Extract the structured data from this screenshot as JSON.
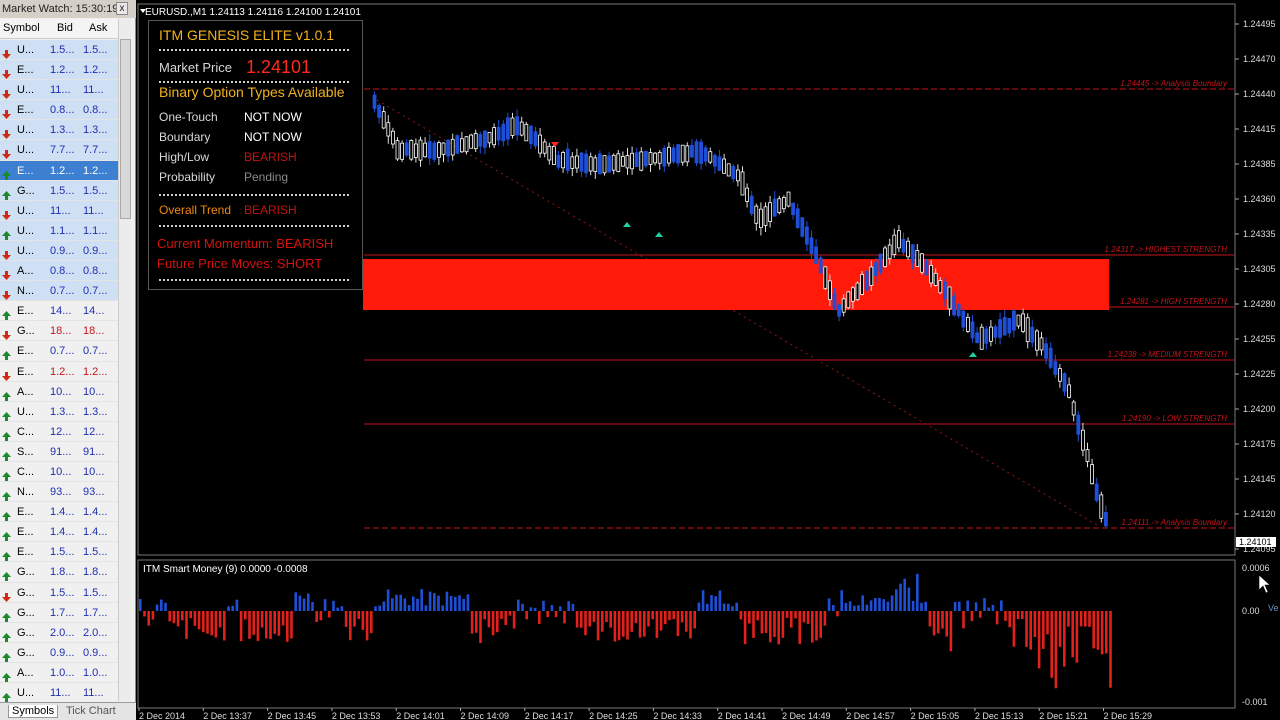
{
  "market_watch": {
    "title": "Market Watch: 15:30:19",
    "close": "x",
    "headers": {
      "symbol": "Symbol",
      "bid": "Bid",
      "ask": "Ask"
    },
    "rows": [
      {
        "symbol": "U...",
        "bid": "1.5...",
        "ask": "1.5...",
        "dir": "down",
        "style": "blue"
      },
      {
        "symbol": "E...",
        "bid": "1.2...",
        "ask": "1.2...",
        "dir": "down",
        "style": "blue"
      },
      {
        "symbol": "U...",
        "bid": "11...",
        "ask": "11...",
        "dir": "down",
        "style": "blue"
      },
      {
        "symbol": "E...",
        "bid": "0.8...",
        "ask": "0.8...",
        "dir": "down",
        "style": "blue"
      },
      {
        "symbol": "U...",
        "bid": "1.3...",
        "ask": "1.3...",
        "dir": "down",
        "style": "blue"
      },
      {
        "symbol": "U...",
        "bid": "7.7...",
        "ask": "7.7...",
        "dir": "down",
        "style": "blue"
      },
      {
        "symbol": "E...",
        "bid": "1.2...",
        "ask": "1.2...",
        "dir": "up",
        "style": "dark"
      },
      {
        "symbol": "G...",
        "bid": "1.5...",
        "ask": "1.5...",
        "dir": "up",
        "style": "blue"
      },
      {
        "symbol": "U...",
        "bid": "11...",
        "ask": "11...",
        "dir": "down",
        "style": "blue"
      },
      {
        "symbol": "U...",
        "bid": "1.1...",
        "ask": "1.1...",
        "dir": "up",
        "style": "blue"
      },
      {
        "symbol": "U...",
        "bid": "0.9...",
        "ask": "0.9...",
        "dir": "down",
        "style": "blue"
      },
      {
        "symbol": "A...",
        "bid": "0.8...",
        "ask": "0.8...",
        "dir": "down",
        "style": "blue"
      },
      {
        "symbol": "N...",
        "bid": "0.7...",
        "ask": "0.7...",
        "dir": "down",
        "style": "blue"
      },
      {
        "symbol": "E...",
        "bid": "14...",
        "ask": "14...",
        "dir": "up",
        "style": "none"
      },
      {
        "symbol": "G...",
        "bid": "18...",
        "ask": "18...",
        "dir": "down",
        "style": "red"
      },
      {
        "symbol": "E...",
        "bid": "0.7...",
        "ask": "0.7...",
        "dir": "up",
        "style": "none"
      },
      {
        "symbol": "E...",
        "bid": "1.2...",
        "ask": "1.2...",
        "dir": "down",
        "style": "red"
      },
      {
        "symbol": "A...",
        "bid": "10...",
        "ask": "10...",
        "dir": "up",
        "style": "none"
      },
      {
        "symbol": "U...",
        "bid": "1.3...",
        "ask": "1.3...",
        "dir": "up",
        "style": "none"
      },
      {
        "symbol": "C...",
        "bid": "12...",
        "ask": "12...",
        "dir": "up",
        "style": "none"
      },
      {
        "symbol": "S...",
        "bid": "91...",
        "ask": "91...",
        "dir": "up",
        "style": "none"
      },
      {
        "symbol": "C...",
        "bid": "10...",
        "ask": "10...",
        "dir": "up",
        "style": "none"
      },
      {
        "symbol": "N...",
        "bid": "93...",
        "ask": "93...",
        "dir": "up",
        "style": "none"
      },
      {
        "symbol": "E...",
        "bid": "1.4...",
        "ask": "1.4...",
        "dir": "up",
        "style": "none"
      },
      {
        "symbol": "E...",
        "bid": "1.4...",
        "ask": "1.4...",
        "dir": "up",
        "style": "none"
      },
      {
        "symbol": "E...",
        "bid": "1.5...",
        "ask": "1.5...",
        "dir": "up",
        "style": "none"
      },
      {
        "symbol": "G...",
        "bid": "1.8...",
        "ask": "1.8...",
        "dir": "up",
        "style": "none"
      },
      {
        "symbol": "G...",
        "bid": "1.5...",
        "ask": "1.5...",
        "dir": "down",
        "style": "none"
      },
      {
        "symbol": "G...",
        "bid": "1.7...",
        "ask": "1.7...",
        "dir": "up",
        "style": "none"
      },
      {
        "symbol": "G...",
        "bid": "2.0...",
        "ask": "2.0...",
        "dir": "up",
        "style": "none"
      },
      {
        "symbol": "G...",
        "bid": "0.9...",
        "ask": "0.9...",
        "dir": "up",
        "style": "none"
      },
      {
        "symbol": "A...",
        "bid": "1.0...",
        "ask": "1.0...",
        "dir": "up",
        "style": "none"
      },
      {
        "symbol": "U...",
        "bid": "11...",
        "ask": "11...",
        "dir": "up",
        "style": "none"
      }
    ],
    "tabs": [
      "Symbols",
      "Tick Chart"
    ]
  },
  "chart": {
    "header": "EURUSD.,M1  1.24113 1.24116 1.24100 1.24101",
    "price_axis": [
      "1.24495",
      "1.24470",
      "1.24440",
      "1.24415",
      "1.24385",
      "1.24360",
      "1.24335",
      "1.24305",
      "1.24280",
      "1.24255",
      "1.24225",
      "1.24200",
      "1.24175",
      "1.24145",
      "1.24120",
      "1.24095"
    ],
    "current_price_tag": "1.24101",
    "level_labels": [
      {
        "text": "1.24445 -> Analysis Boundary"
      },
      {
        "text": "1.24317 -> HIGHEST STRENGTH"
      },
      {
        "text": "1.24281 -> HIGH STRENGTH"
      },
      {
        "text": "1.24238 -> MEDIUM STRENGTH"
      },
      {
        "text": "1.24190 -> LOW STRENGTH"
      },
      {
        "text": "1.24111 -> Analysis Boundary"
      }
    ],
    "time_axis": [
      "2 Dec 2014",
      "2 Dec 13:37",
      "2 Dec 13:45",
      "2 Dec 13:53",
      "2 Dec 14:01",
      "2 Dec 14:09",
      "2 Dec 14:17",
      "2 Dec 14:25",
      "2 Dec 14:33",
      "2 Dec 14:41",
      "2 Dec 14:49",
      "2 Dec 14:57",
      "2 Dec 15:05",
      "2 Dec 15:13",
      "2 Dec 15:21",
      "2 Dec 15:29"
    ],
    "colors": {
      "bull": "#1f4fd8",
      "bear": "#e3211c",
      "zone": "#ff1a0a",
      "level": "#c4141a"
    }
  },
  "panel": {
    "title": "ITM GENESIS ELITE v1.0.1",
    "market_price_label": "Market Price",
    "market_price_value": "1.24101",
    "binary_title": "Binary Option Types Available",
    "rows": [
      {
        "label": "One-Touch",
        "value": "NOT NOW"
      },
      {
        "label": "Boundary",
        "value": "NOT NOW"
      },
      {
        "label": "High/Low",
        "value": "BEARISH"
      },
      {
        "label": "Probability",
        "value": "Pending"
      }
    ],
    "overall_trend_label": "Overall Trend",
    "overall_trend_value": "BEARISH",
    "momentum": "Current Momentum: BEARISH",
    "future": "Future Price Moves: SHORT"
  },
  "indicator": {
    "title": "ITM Smart Money (9) 0.0000 -0.0008",
    "axis": [
      "0.0006",
      "0.00",
      "-0.001"
    ]
  },
  "cursor_label": "Ve"
}
